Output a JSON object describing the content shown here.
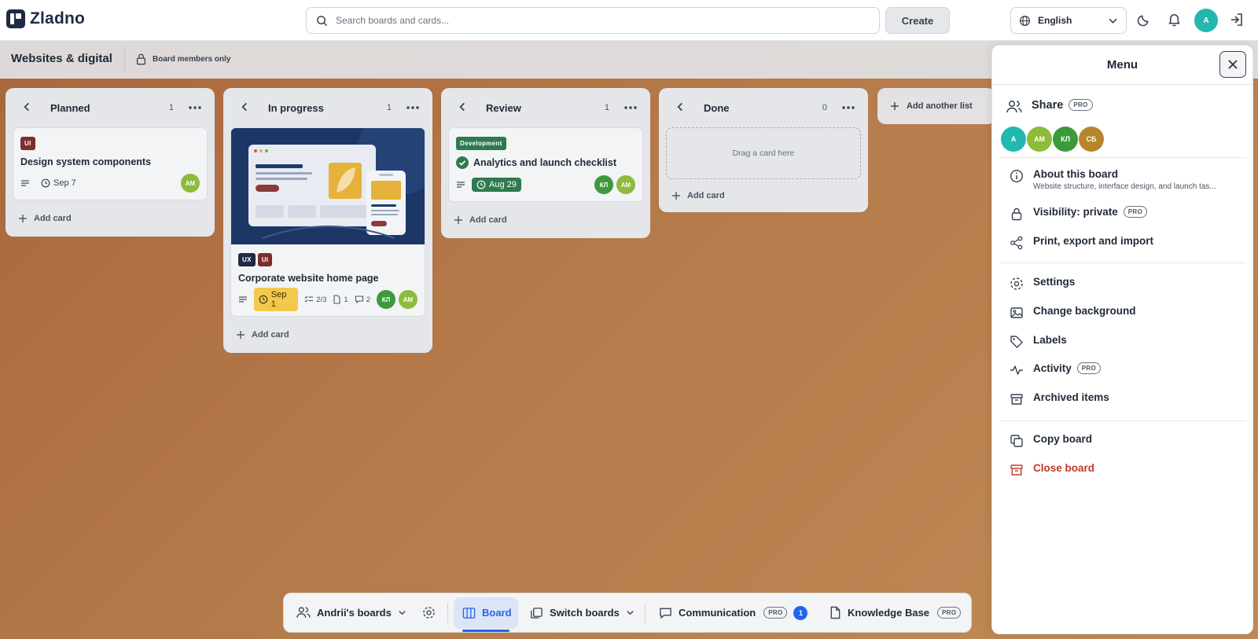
{
  "app": {
    "name": "Zladno"
  },
  "header": {
    "search_placeholder": "Search boards and cards...",
    "create_label": "Create",
    "language": "English",
    "user_initial": "A"
  },
  "board": {
    "title": "Websites & digital",
    "visibility": "Board members only"
  },
  "lists": [
    {
      "title": "Planned",
      "count": "1",
      "add_card": "Add card",
      "cards": [
        {
          "labels": [
            "UI"
          ],
          "title": "Design system components",
          "due": "Sep 7",
          "members": [
            "AM"
          ]
        }
      ]
    },
    {
      "title": "In progress",
      "count": "1",
      "add_card": "Add card",
      "cards": [
        {
          "labels": [
            "UX",
            "UI"
          ],
          "title": "Corporate website home page",
          "due": "Sep 1",
          "checklist": "2/3",
          "attachments": "1",
          "comments": "2",
          "members": [
            "КЛ",
            "AM"
          ]
        }
      ]
    },
    {
      "title": "Review",
      "count": "1",
      "add_card": "Add card",
      "cards": [
        {
          "labels": [
            "Development"
          ],
          "title": "Analytics and launch checklist",
          "due": "Aug 29",
          "members": [
            "КЛ",
            "AM"
          ]
        }
      ]
    },
    {
      "title": "Done",
      "count": "0",
      "add_card": "Add card",
      "dropzone": "Drag a card here"
    }
  ],
  "add_list_label": "Add another list",
  "menu": {
    "title": "Menu",
    "pro_badge": "PRO",
    "share": "Share",
    "share_members": [
      "A",
      "AM",
      "КЛ",
      "СБ"
    ],
    "about": {
      "label": "About this board",
      "description": "Website structure, interface design, and launch tas..."
    },
    "visibility": "Visibility: private",
    "print": "Print, export and import",
    "settings": "Settings",
    "background": "Change background",
    "labels": "Labels",
    "activity": "Activity",
    "archived": "Archived items",
    "copy": "Copy board",
    "close": "Close board"
  },
  "bottom": {
    "boards": "Andrii's boards",
    "board": "Board",
    "switch": "Switch boards",
    "communication": "Communication",
    "comm_badge": "1",
    "knowledge": "Knowledge Base"
  },
  "colors": {
    "label_ui": "#7a2e2e",
    "label_ux": "#1f2a44",
    "label_dev": "#2f7a4f",
    "avatar_teal": "#22b8b0",
    "avatar_lime": "#8dbb3a",
    "avatar_green": "#3c9a3c",
    "avatar_amber": "#b8862a",
    "due_warning": "#f2c94c",
    "due_done": "#2f7a4f",
    "accent": "#2563eb",
    "danger": "#c0392b"
  }
}
